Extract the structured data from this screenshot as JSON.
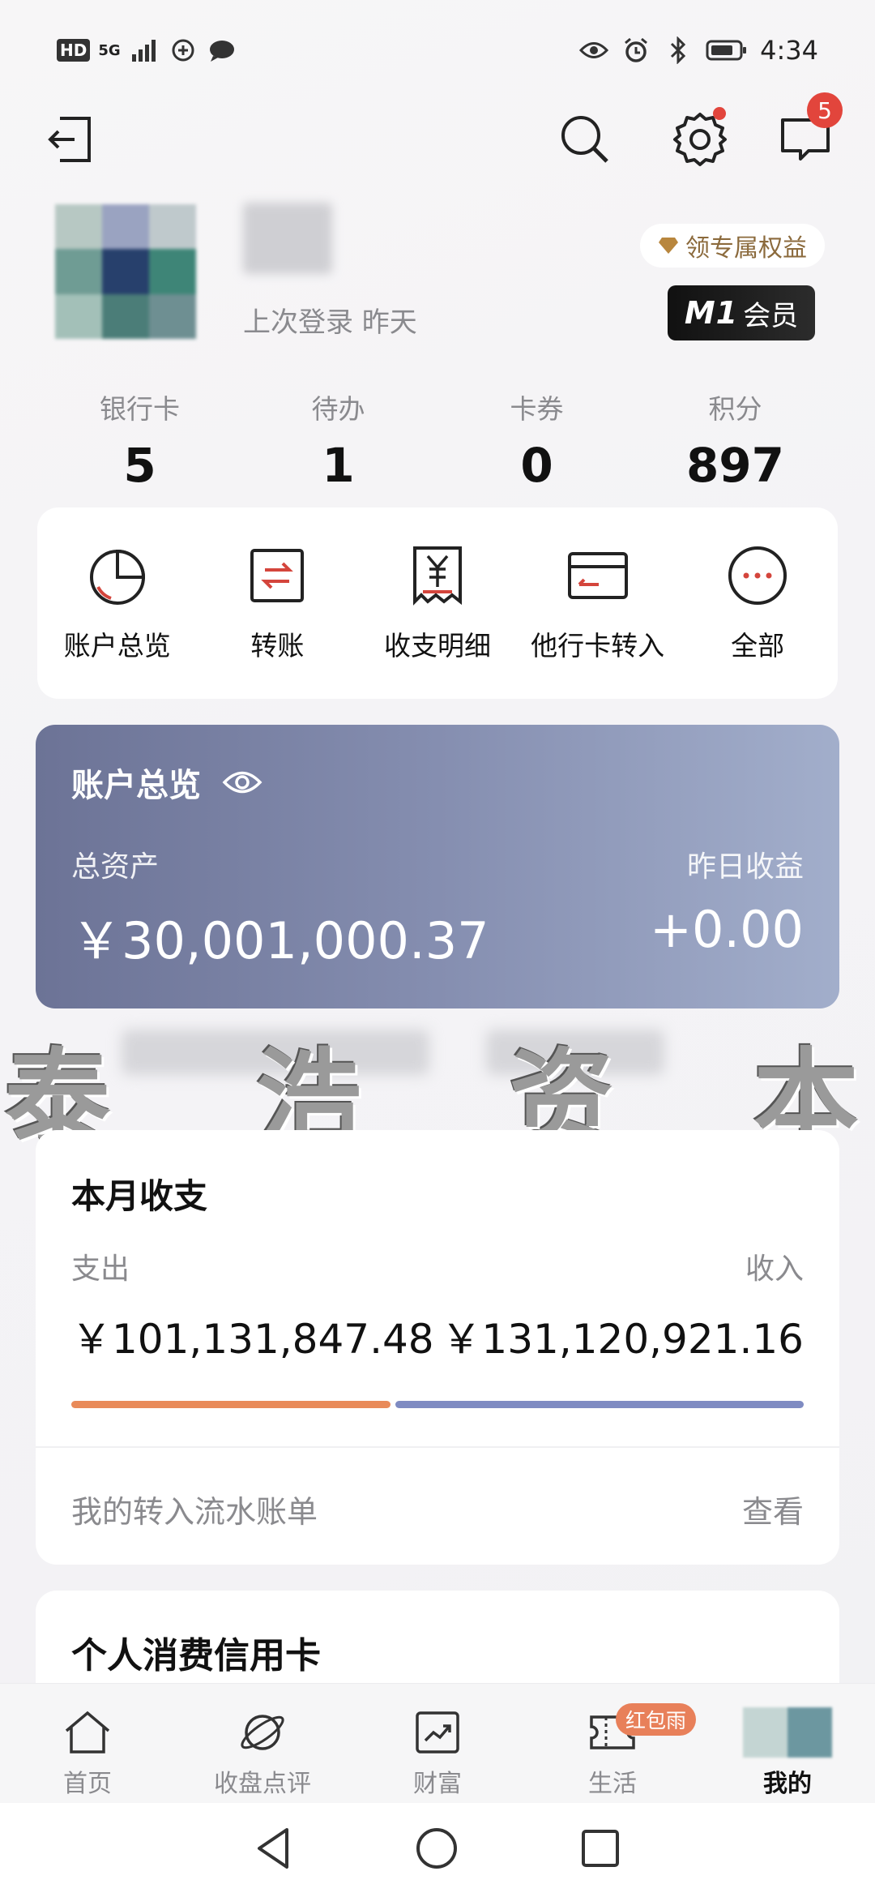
{
  "status_bar": {
    "network_labels": [
      "HD",
      "5G"
    ],
    "time": "4:34"
  },
  "header": {
    "message_count": "5"
  },
  "profile": {
    "last_login": "上次登录 昨天",
    "benefits_label": "领专属权益",
    "member_tier": "M1",
    "member_label": "会员"
  },
  "stats": [
    {
      "label": "银行卡",
      "value": "5"
    },
    {
      "label": "待办",
      "value": "1"
    },
    {
      "label": "卡券",
      "value": "0"
    },
    {
      "label": "积分",
      "value": "897"
    }
  ],
  "quick_actions": [
    {
      "label": "账户总览",
      "icon": "pie-chart-icon"
    },
    {
      "label": "转账",
      "icon": "transfer-icon"
    },
    {
      "label": "收支明细",
      "icon": "receipt-icon"
    },
    {
      "label": "他行卡转入",
      "icon": "card-transfer-icon"
    },
    {
      "label": "全部",
      "icon": "more-icon"
    }
  ],
  "overview": {
    "title": "账户总览",
    "total_assets_label": "总资产",
    "total_assets": "￥30,001,000.37",
    "yesterday_income_label": "昨日收益",
    "yesterday_income": "+0.00"
  },
  "watermark": {
    "chars": [
      "泰",
      "浩",
      "资",
      "本"
    ]
  },
  "monthly": {
    "title": "本月收支",
    "expense_label": "支出",
    "income_label": "收入",
    "expense": "￥101,131,847.48",
    "income": "￥131,120,921.16",
    "expense_ratio": 0.436,
    "link_label": "我的转入流水账单",
    "view_label": "查看"
  },
  "credit": {
    "title": "个人消费信用卡"
  },
  "bottom_nav": [
    {
      "label": "首页",
      "icon": "home-icon",
      "active": false
    },
    {
      "label": "收盘点评",
      "icon": "planet-icon",
      "active": false
    },
    {
      "label": "财富",
      "icon": "trend-chart-icon",
      "active": false
    },
    {
      "label": "生活",
      "icon": "ticket-icon",
      "active": false,
      "badge": "红包雨"
    },
    {
      "label": "我的",
      "icon": "avatar",
      "active": true
    }
  ],
  "colors": {
    "badge_red": "#e2453c",
    "expense_bar": "#e98a59",
    "income_bar": "#7f8bc2",
    "overview_start": "#6c7396",
    "overview_end": "#a2aecb"
  }
}
